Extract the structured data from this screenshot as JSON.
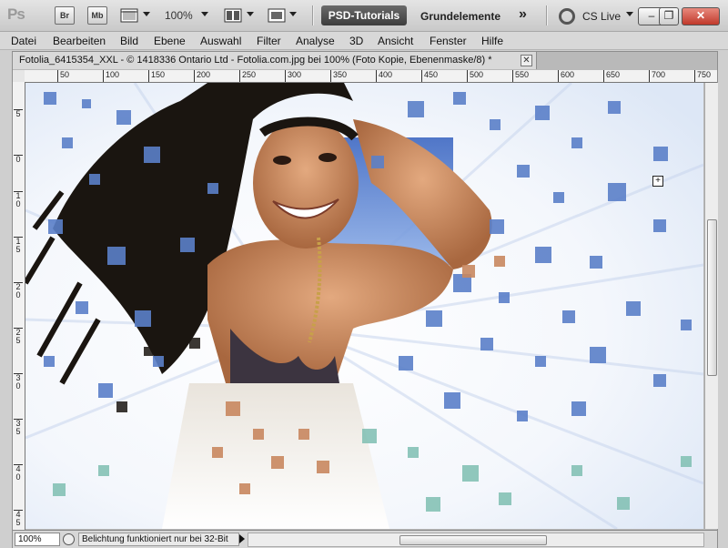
{
  "appbar": {
    "logo": "Ps",
    "bridge": "Br",
    "minibridge": "Mb",
    "zoom": "100%",
    "workspace_active": "PSD-Tutorials",
    "workspace": "Grundelemente",
    "more": "»",
    "cslive": "CS Live",
    "icons": [
      "bridge-icon",
      "mini-bridge-icon",
      "frame-icon",
      "arrange-documents-icon",
      "screen-mode-icon"
    ]
  },
  "window_buttons": {
    "minimize": "–",
    "restore": "❐",
    "close": "✕"
  },
  "menu": [
    "Datei",
    "Bearbeiten",
    "Bild",
    "Ebene",
    "Auswahl",
    "Filter",
    "Analyse",
    "3D",
    "Ansicht",
    "Fenster",
    "Hilfe"
  ],
  "document": {
    "tab_title": "Fotolia_6415354_XXL - © 1418336 Ontario Ltd - Fotolia.com.jpg bei 100% (Foto Kopie, Ebenenmaske/8) *",
    "close": "✕"
  },
  "hruler": [
    "50",
    "100",
    "150",
    "200",
    "250",
    "300",
    "350",
    "400",
    "450",
    "500",
    "550",
    "600",
    "650",
    "700",
    "750"
  ],
  "vruler": [
    "5",
    "0",
    "1 0",
    "1 5",
    "2 0",
    "2 5",
    "3 0",
    "3 5",
    "4 0",
    "4 5",
    "5 0"
  ],
  "status": {
    "zoom": "100%",
    "message": "Belichtung funktioniert nur bei 32-Bit"
  },
  "colors": {
    "sky_blue": "#5f86cf",
    "skin": "#c98860",
    "hair": "#1a1510",
    "bg_white": "#ffffff",
    "workspace_active_bg": "#4a4a4a"
  }
}
